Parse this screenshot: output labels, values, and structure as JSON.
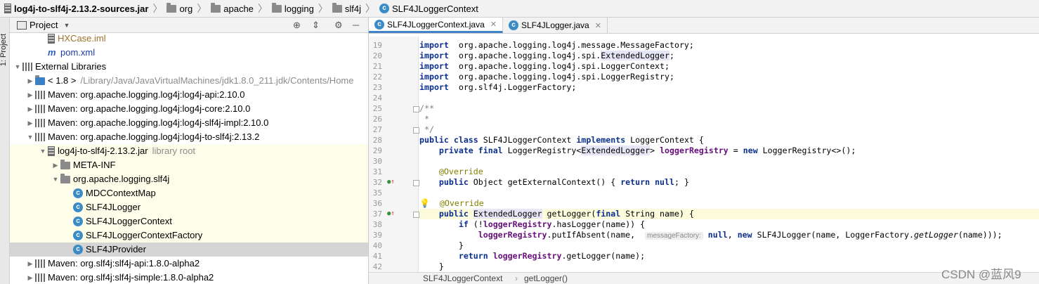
{
  "breadcrumb": [
    {
      "label": "log4j-to-slf4j-2.13.2-sources.jar",
      "icon": "jar-icon"
    },
    {
      "label": "org",
      "icon": "folder-icon"
    },
    {
      "label": "apache",
      "icon": "folder-icon"
    },
    {
      "label": "logging",
      "icon": "folder-icon"
    },
    {
      "label": "slf4j",
      "icon": "folder-icon"
    },
    {
      "label": "SLF4JLoggerContext",
      "icon": "class-icon"
    }
  ],
  "side_stripe": {
    "label": "1: Project"
  },
  "project_panel": {
    "title": "Project",
    "tools": [
      "locate-icon",
      "collapse-icon",
      "gear-icon",
      "hide-icon"
    ]
  },
  "tree": [
    {
      "label": "HXCase.iml",
      "indent": 2,
      "icon": "module-file-icon",
      "arrow": "",
      "hl": false,
      "sel": false,
      "cls": "modfile"
    },
    {
      "label": "pom.xml",
      "indent": 2,
      "icon": "maven-icon",
      "arrow": "",
      "hl": false,
      "sel": false,
      "cls": "pomfile"
    },
    {
      "label": "External Libraries",
      "indent": 0,
      "icon": "library-icon",
      "arrow": "down",
      "hl": false,
      "sel": false
    },
    {
      "label": "< 1.8 >",
      "suffix": "/Library/Java/JavaVirtualMachines/jdk1.8.0_211.jdk/Contents/Home",
      "indent": 1,
      "icon": "jdk-icon",
      "arrow": "right",
      "hl": false,
      "sel": false
    },
    {
      "label": "Maven: org.apache.logging.log4j:log4j-api:2.10.0",
      "indent": 1,
      "icon": "library-icon",
      "arrow": "right",
      "hl": false,
      "sel": false
    },
    {
      "label": "Maven: org.apache.logging.log4j:log4j-core:2.10.0",
      "indent": 1,
      "icon": "library-icon",
      "arrow": "right",
      "hl": false,
      "sel": false
    },
    {
      "label": "Maven: org.apache.logging.log4j:log4j-slf4j-impl:2.10.0",
      "indent": 1,
      "icon": "library-icon",
      "arrow": "right",
      "hl": false,
      "sel": false
    },
    {
      "label": "Maven: org.apache.logging.log4j:log4j-to-slf4j:2.13.2",
      "indent": 1,
      "icon": "library-icon",
      "arrow": "down",
      "hl": false,
      "sel": false
    },
    {
      "label": "log4j-to-slf4j-2.13.2.jar",
      "suffix": "library root",
      "indent": 2,
      "icon": "jar-icon",
      "arrow": "down",
      "hl": true,
      "sel": false
    },
    {
      "label": "META-INF",
      "indent": 3,
      "icon": "folder-icon",
      "arrow": "right",
      "hl": true,
      "sel": false
    },
    {
      "label": "org.apache.logging.slf4j",
      "indent": 3,
      "icon": "package-icon",
      "arrow": "down",
      "hl": true,
      "sel": false
    },
    {
      "label": "MDCContextMap",
      "indent": 4,
      "icon": "class-icon",
      "arrow": "",
      "hl": true,
      "sel": false
    },
    {
      "label": "SLF4JLogger",
      "indent": 4,
      "icon": "class-icon",
      "arrow": "",
      "hl": true,
      "sel": false
    },
    {
      "label": "SLF4JLoggerContext",
      "indent": 4,
      "icon": "class-icon",
      "arrow": "",
      "hl": true,
      "sel": false
    },
    {
      "label": "SLF4JLoggerContextFactory",
      "indent": 4,
      "icon": "class-icon",
      "arrow": "",
      "hl": true,
      "sel": false
    },
    {
      "label": "SLF4JProvider",
      "indent": 4,
      "icon": "class-icon",
      "arrow": "",
      "hl": false,
      "sel": true
    },
    {
      "label": "Maven: org.slf4j:slf4j-api:1.8.0-alpha2",
      "indent": 1,
      "icon": "library-icon",
      "arrow": "right",
      "hl": false,
      "sel": false
    },
    {
      "label": "Maven: org.slf4j:slf4j-simple:1.8.0-alpha2",
      "indent": 1,
      "icon": "library-icon",
      "arrow": "right",
      "hl": false,
      "sel": false
    }
  ],
  "tabs": [
    {
      "label": "SLF4JLoggerContext.java",
      "active": true
    },
    {
      "label": "SLF4JLogger.java",
      "active": false
    }
  ],
  "code": [
    {
      "n": "19",
      "segs": [
        [
          "kw",
          "import"
        ],
        [
          "",
          "  org.apache.logging.log4j.message.MessageFactory;"
        ]
      ]
    },
    {
      "n": "20",
      "segs": [
        [
          "kw",
          "import"
        ],
        [
          "",
          "  org.apache.logging.log4j.spi."
        ],
        [
          "hlref",
          "ExtendedLogger"
        ],
        [
          "",
          ";"
        ]
      ]
    },
    {
      "n": "21",
      "segs": [
        [
          "kw",
          "import"
        ],
        [
          "",
          "  org.apache.logging.log4j.spi.LoggerContext;"
        ]
      ]
    },
    {
      "n": "22",
      "segs": [
        [
          "kw",
          "import"
        ],
        [
          "",
          "  org.apache.logging.log4j.spi.LoggerRegistry;"
        ]
      ]
    },
    {
      "n": "23",
      "segs": [
        [
          "kw",
          "import"
        ],
        [
          "",
          "  org.slf4j.LoggerFactory;"
        ]
      ]
    },
    {
      "n": "24",
      "segs": []
    },
    {
      "n": "25",
      "segs": [
        [
          "cm",
          "/**"
        ]
      ],
      "fold": true
    },
    {
      "n": "26",
      "segs": [
        [
          "cm",
          " *"
        ]
      ]
    },
    {
      "n": "27",
      "segs": [
        [
          "cm",
          " */"
        ]
      ],
      "fold": true
    },
    {
      "n": "28",
      "segs": [
        [
          "kw",
          "public class"
        ],
        [
          "",
          " SLF4JLoggerContext "
        ],
        [
          "kw",
          "implements"
        ],
        [
          "",
          " LoggerContext {"
        ]
      ]
    },
    {
      "n": "29",
      "segs": [
        [
          "",
          "    "
        ],
        [
          "kw",
          "private final"
        ],
        [
          "",
          " LoggerRegistry<"
        ],
        [
          "hlref",
          "ExtendedLogger"
        ],
        [
          "",
          "> "
        ],
        [
          "fld",
          "loggerRegistry"
        ],
        [
          "",
          " = "
        ],
        [
          "kw",
          "new"
        ],
        [
          "",
          " LoggerRegistry<>();"
        ]
      ]
    },
    {
      "n": "30",
      "segs": []
    },
    {
      "n": "31",
      "segs": [
        [
          "",
          "    "
        ],
        [
          "an",
          "@Override"
        ]
      ]
    },
    {
      "n": "32",
      "segs": [
        [
          "",
          "    "
        ],
        [
          "kw",
          "public"
        ],
        [
          "",
          " Object getExternalContext() { "
        ],
        [
          "kw",
          "return null"
        ],
        [
          "",
          "; }"
        ]
      ],
      "mark": true,
      "fold": true
    },
    {
      "n": "35",
      "segs": []
    },
    {
      "n": "36",
      "segs": [
        [
          "bulb",
          "💡"
        ],
        [
          "",
          "  "
        ],
        [
          "an",
          "@Override"
        ]
      ]
    },
    {
      "n": "37",
      "segs": [
        [
          "",
          "    "
        ],
        [
          "kw",
          "public"
        ],
        [
          "",
          " "
        ],
        [
          "hlref",
          "ExtendedLogger"
        ],
        [
          "",
          " getLogger("
        ],
        [
          "kw",
          "final"
        ],
        [
          "",
          " String name) {"
        ]
      ],
      "mark": true,
      "fold": true,
      "curr": true
    },
    {
      "n": "38",
      "segs": [
        [
          "",
          "        "
        ],
        [
          "kw",
          "if"
        ],
        [
          "",
          " (!"
        ],
        [
          "fld",
          "loggerRegistry"
        ],
        [
          "",
          ".hasLogger(name)) {"
        ]
      ]
    },
    {
      "n": "39",
      "segs": [
        [
          "",
          "            "
        ],
        [
          "fld",
          "loggerRegistry"
        ],
        [
          "",
          ".putIfAbsent(name,  "
        ],
        [
          "hint",
          "messageFactory:"
        ],
        [
          "",
          " "
        ],
        [
          "kw",
          "null"
        ],
        [
          "",
          ", "
        ],
        [
          "kw",
          "new"
        ],
        [
          "",
          " SLF4JLogger(name, LoggerFactory."
        ],
        [
          "it",
          "getLogger"
        ],
        [
          "",
          "(name)));"
        ]
      ]
    },
    {
      "n": "40",
      "segs": [
        [
          "",
          "        }"
        ]
      ]
    },
    {
      "n": "41",
      "segs": [
        [
          "",
          "        "
        ],
        [
          "kw",
          "return"
        ],
        [
          "",
          " "
        ],
        [
          "fld",
          "loggerRegistry"
        ],
        [
          "",
          ".getLogger(name);"
        ]
      ]
    },
    {
      "n": "42",
      "segs": [
        [
          "",
          "    }"
        ]
      ]
    }
  ],
  "editor_breadcrumb": {
    "cls": "SLF4JLoggerContext",
    "method": "getLogger()"
  },
  "watermark": "CSDN @蓝风9"
}
